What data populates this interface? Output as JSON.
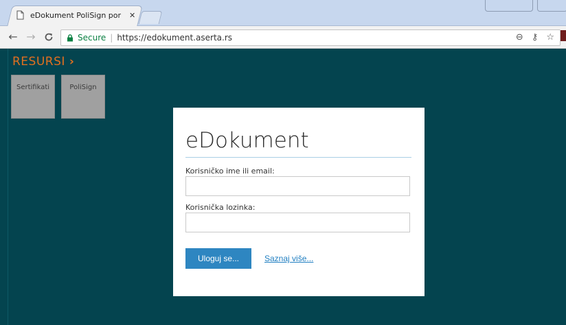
{
  "browser": {
    "tab_title": "eDokument PoliSign por",
    "tab_close": "✕",
    "secure_label": "Secure",
    "separator": "|",
    "url": "https://edokument.aserta.rs"
  },
  "sidebar": {
    "heading": "RESURSI",
    "heading_arrow": "›",
    "tiles": [
      {
        "label": "Sertifikati"
      },
      {
        "label": "PoliSign"
      }
    ]
  },
  "login": {
    "title": "eDokument",
    "username_label": "Korisničko ime ili email:",
    "username_value": "",
    "password_label": "Korisnička lozinka:",
    "password_value": "",
    "submit_label": "Uloguj se...",
    "more_link": "Saznaj više..."
  },
  "colors": {
    "page_background": "#04444f",
    "accent_orange": "#e2701f",
    "button_blue": "#2e86c1",
    "link_blue": "#1f7ec1",
    "secure_green": "#0b8043"
  }
}
